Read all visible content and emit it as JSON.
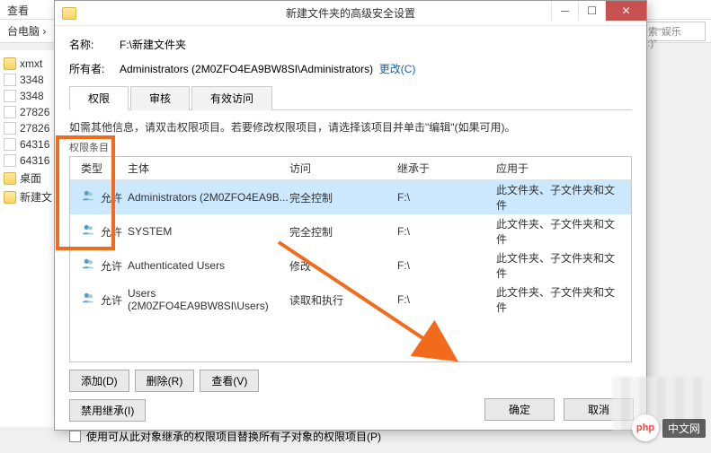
{
  "explorer": {
    "toolbar_label": "查看",
    "breadcrumb": "台电脑 ›",
    "search_placeholder": "搜索\"娱乐 (F:)\""
  },
  "sidebar": {
    "items": [
      {
        "label": "xmxt",
        "icon": "folder"
      },
      {
        "label": "3348",
        "icon": "file"
      },
      {
        "label": "3348",
        "icon": "file"
      },
      {
        "label": "27826",
        "icon": "file"
      },
      {
        "label": "27826",
        "icon": "file"
      },
      {
        "label": "64316",
        "icon": "file"
      },
      {
        "label": "64316",
        "icon": "file"
      },
      {
        "label": "桌面",
        "icon": "folder"
      },
      {
        "label": "新建文",
        "icon": "folder"
      }
    ]
  },
  "dialog": {
    "title": "新建文件夹的高级安全设置",
    "name_label": "名称:",
    "name_value": "F:\\新建文件夹",
    "owner_label": "所有者:",
    "owner_value": "Administrators (2M0ZFO4EA9BW8SI\\Administrators)",
    "owner_change": "更改(C)",
    "tabs": [
      "权限",
      "审核",
      "有效访问"
    ],
    "active_tab": 0,
    "info_text": "如需其他信息，请双击权限项目。若要修改权限项目，请选择该项目并单击\"编辑\"(如果可用)。",
    "sub_label": "权限条目",
    "headers": {
      "type": "类型",
      "principal": "主体",
      "access": "访问",
      "inherit": "继承于",
      "apply": "应用于"
    },
    "rows": [
      {
        "type": "允许",
        "principal": "Administrators (2M0ZFO4EA9B...",
        "access": "完全控制",
        "inherit": "F:\\",
        "apply": "此文件夹、子文件夹和文件"
      },
      {
        "type": "允许",
        "principal": "SYSTEM",
        "access": "完全控制",
        "inherit": "F:\\",
        "apply": "此文件夹、子文件夹和文件"
      },
      {
        "type": "允许",
        "principal": "Authenticated Users",
        "access": "修改",
        "inherit": "F:\\",
        "apply": "此文件夹、子文件夹和文件"
      },
      {
        "type": "允许",
        "principal": "Users (2M0ZFO4EA9BW8SI\\Users)",
        "access": "读取和执行",
        "inherit": "F:\\",
        "apply": "此文件夹、子文件夹和文件"
      }
    ],
    "buttons": {
      "add": "添加(D)",
      "remove": "删除(R)",
      "view": "查看(V)",
      "disable_inherit": "禁用继承(I)",
      "ok": "确定",
      "cancel": "取消"
    },
    "checkbox_label": "使用可从此对象继承的权限项目替换所有子对象的权限项目(P)"
  },
  "watermark": {
    "logo": "php",
    "text": "中文网"
  }
}
